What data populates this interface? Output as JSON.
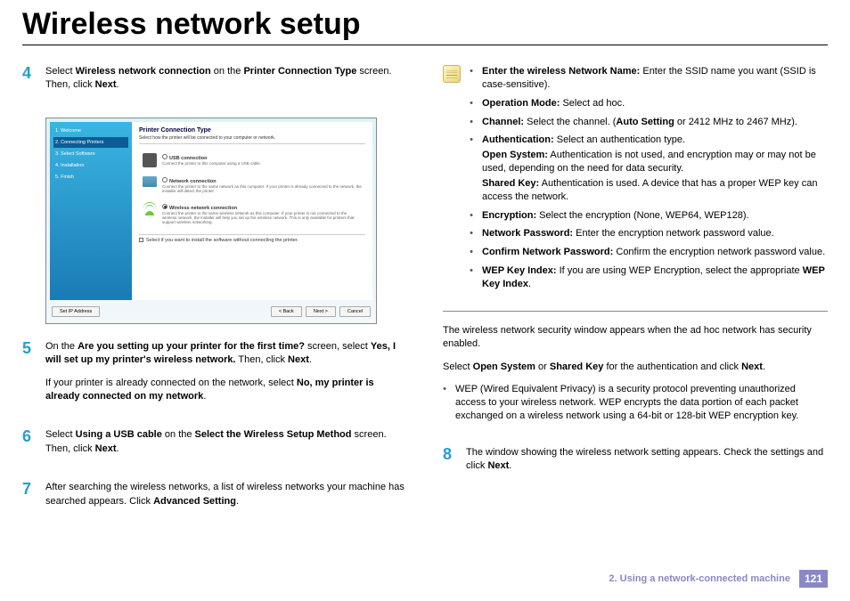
{
  "title": "Wireless network setup",
  "steps": {
    "s4": {
      "num": "4",
      "p1a": "Select ",
      "p1b": "Wireless network connection",
      "p1c": " on the ",
      "p1d": "Printer Connection Type",
      "p1e": " screen. Then, click ",
      "p1f": "Next",
      "p1g": "."
    },
    "s5": {
      "num": "5",
      "p1a": "On the ",
      "p1b": "Are you setting up your printer for the first time?",
      "p1c": " screen, select ",
      "p1d": "Yes, I will set up my printer's wireless network.",
      "p1e": " Then, click ",
      "p1f": "Next",
      "p1g": ".",
      "p2a": "If your printer is already connected on the network, select ",
      "p2b": "No, my printer is already connected on my network",
      "p2c": "."
    },
    "s6": {
      "num": "6",
      "p1a": "Select ",
      "p1b": "Using a USB cable",
      "p1c": " on the ",
      "p1d": "Select the Wireless Setup Method",
      "p1e": " screen. Then, click ",
      "p1f": "Next",
      "p1g": "."
    },
    "s7": {
      "num": "7",
      "p1a": "After searching the wireless networks, a list of wireless networks your machine has searched appears. Click ",
      "p1b": "Advanced Setting",
      "p1c": "."
    },
    "s8": {
      "num": "8",
      "p1a": "The window showing the wireless network setting appears. Check the settings and click ",
      "p1b": "Next",
      "p1c": "."
    }
  },
  "note": {
    "b1": {
      "t": "Enter the wireless Network Name:",
      "d": " Enter the SSID name you want (SSID is case-sensitive)."
    },
    "b2": {
      "t": "Operation Mode:",
      "d": " Select ad hoc."
    },
    "b3": {
      "t": "Channel:",
      "d1": " Select the channel. (",
      "d2": "Auto Setting",
      "d3": " or 2412 MHz to 2467 MHz)."
    },
    "b4": {
      "t": "Authentication:",
      "d": " Select an authentication type.",
      "sub1t": "Open System:",
      "sub1d": " Authentication is not used, and encryption may or may not be used, depending on the need for data security.",
      "sub2t": "Shared Key:",
      "sub2d": " Authentication is used. A device that has a proper WEP key can access the network."
    },
    "b5": {
      "t": "Encryption:",
      "d": " Select the encryption (None, WEP64, WEP128)."
    },
    "b6": {
      "t": "Network Password:",
      "d": " Enter the encryption network password value."
    },
    "b7": {
      "t": "Confirm Network Password:",
      "d": " Confirm the encryption network password value."
    },
    "b8": {
      "t": "WEP Key Index:",
      "d1": " If you are using WEP Encryption, select the appropriate ",
      "d2": "WEP Key Index",
      "d3": "."
    }
  },
  "post": {
    "p1": "The wireless network security window appears when the ad hoc network has security enabled.",
    "p2a": "Select ",
    "p2b": "Open System",
    "p2c": " or ",
    "p2d": "Shared Key",
    "p2e": " for the authentication and click ",
    "p2f": "Next",
    "p2g": ".",
    "wep": "WEP (Wired Equivalent Privacy) is a security protocol preventing unauthorized access to your wireless network. WEP encrypts the data portion of each packet exchanged on a wireless network using a 64-bit or 128-bit WEP encryption key."
  },
  "screenshot": {
    "side": {
      "s1": "1. Welcome",
      "s2": "2. Connecting Printers",
      "s3": "3. Select Software",
      "s4": "4. Installation",
      "s5": "5. Finish"
    },
    "pane_title": "Printer Connection Type",
    "pane_sub": "Select how the printer will be connected to your computer or network.",
    "o1t": "USB connection",
    "o1d": "Connect the printer to this computer using a USB cable.",
    "o2t": "Network connection",
    "o2d": "Connect the printer to the same network as this computer. If your printer is already connected to the network, the installer will detect the printer.",
    "o3t": "Wireless network connection",
    "o3d": "Connect the printer to the same wireless network as this computer. If your printer is not connected to the wireless network, the installer will help you set up the wireless network. This is only available for printers that support wireless networking.",
    "chk": "Select if you want to install the software without connecting the printer.",
    "btn_ip": "Set IP Address",
    "btn_back": "< Back",
    "btn_next": "Next >",
    "btn_cancel": "Cancel"
  },
  "footer": {
    "chapter": "2.  Using a network-connected machine",
    "page": "121"
  }
}
